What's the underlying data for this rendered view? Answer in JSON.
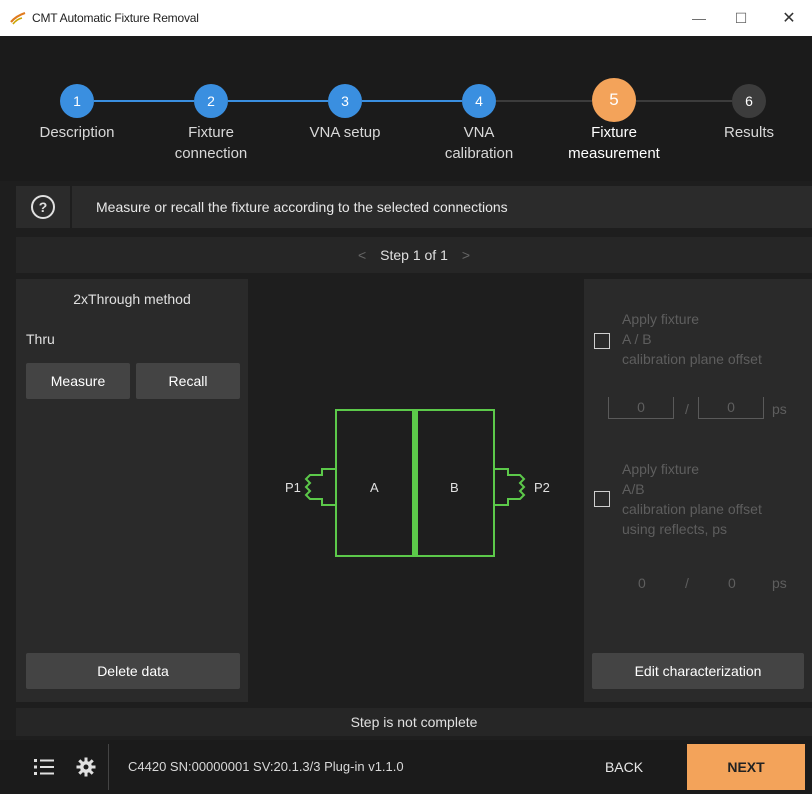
{
  "window": {
    "title": "CMT Automatic Fixture Removal",
    "controls": {
      "minimize": "—",
      "maximize": "☐",
      "close": "✕"
    }
  },
  "stepper": {
    "steps": [
      {
        "num": "1",
        "label_line1": "Description",
        "label_line2": "",
        "state": "done"
      },
      {
        "num": "2",
        "label_line1": "Fixture",
        "label_line2": "connection",
        "state": "done"
      },
      {
        "num": "3",
        "label_line1": "VNA setup",
        "label_line2": "",
        "state": "done"
      },
      {
        "num": "4",
        "label_line1": "VNA",
        "label_line2": "calibration",
        "state": "done"
      },
      {
        "num": "5",
        "label_line1": "Fixture",
        "label_line2": "measurement",
        "state": "active"
      },
      {
        "num": "6",
        "label_line1": "Results",
        "label_line2": "",
        "state": "pending"
      }
    ],
    "colors": {
      "done": "#3a8fe0",
      "active": "#f3a35a",
      "pending": "#3c3c3c"
    }
  },
  "info": {
    "help_glyph": "?",
    "message": "Measure or recall the fixture according to the selected connections"
  },
  "step_nav": {
    "prev": "<",
    "label": "Step 1 of 1",
    "next": ">"
  },
  "left_panel": {
    "method": "2xThrough method",
    "thru_label": "Thru",
    "measure_button": "Measure",
    "recall_button": "Recall",
    "delete_button": "Delete data"
  },
  "diagram": {
    "port1": "P1",
    "port2": "P2",
    "fixture_a": "A",
    "fixture_b": "B",
    "color": "#5cc94a"
  },
  "right_panel": {
    "offset1": {
      "line1": "Apply fixture",
      "line2": "A / B",
      "line3": "calibration plane offset",
      "value_a": "0",
      "separator": "/",
      "value_b": "0",
      "unit": "ps"
    },
    "offset2": {
      "line1": "Apply fixture",
      "line2": "A/B",
      "line3": "calibration plane offset",
      "line4": "using reflects, ps",
      "value_a": "0",
      "separator": "/",
      "value_b": "0",
      "unit": "ps"
    },
    "edit_button": "Edit characterization"
  },
  "status": {
    "text": "Step is not complete"
  },
  "bottom": {
    "device_info": "C4420 SN:00000001 SV:20.1.3/3 Plug-in v1.1.0",
    "back_button": "BACK",
    "next_button": "NEXT",
    "next_color": "#f3a35a"
  }
}
